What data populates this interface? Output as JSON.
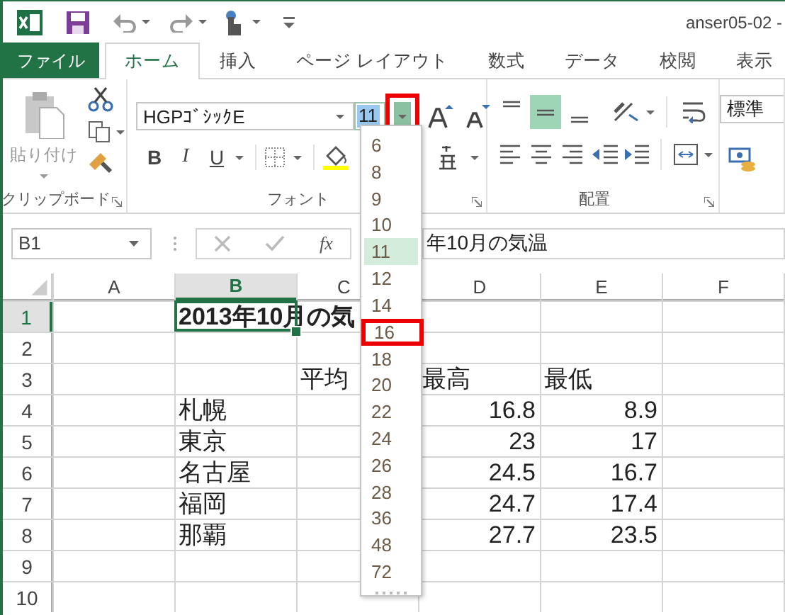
{
  "title_bar": {
    "title": "anser05-02 -"
  },
  "tabs": [
    {
      "label": "ファイル",
      "kind": "file",
      "selected": false
    },
    {
      "label": "ホーム",
      "kind": "tab",
      "selected": true
    },
    {
      "label": "挿入",
      "kind": "tab",
      "selected": false
    },
    {
      "label": "ページ レイアウト",
      "kind": "tab",
      "selected": false
    },
    {
      "label": "数式",
      "kind": "tab",
      "selected": false
    },
    {
      "label": "データ",
      "kind": "tab",
      "selected": false
    },
    {
      "label": "校閲",
      "kind": "tab",
      "selected": false
    },
    {
      "label": "表示",
      "kind": "tab",
      "selected": false
    }
  ],
  "ribbon": {
    "clipboard": {
      "paste_label": "貼り付け",
      "group_label": "クリップボード"
    },
    "font": {
      "font_name": "HGPｺﾞｼｯｸE",
      "font_size": "11",
      "size_button_annotated": true,
      "bold": "B",
      "italic": "I",
      "underline": "U",
      "group_label": "フォント"
    },
    "alignment": {
      "group_label": "配置",
      "vertical_buttons": [
        {
          "kind": "top",
          "selected": false
        },
        {
          "kind": "middle",
          "selected": true
        },
        {
          "kind": "bottom",
          "selected": false
        }
      ]
    },
    "number": {
      "format": "標準"
    }
  },
  "font_size_menu": {
    "items": [
      {
        "label": "6",
        "selected": false,
        "annotated": false
      },
      {
        "label": "8",
        "selected": false,
        "annotated": false
      },
      {
        "label": "9",
        "selected": false,
        "annotated": false
      },
      {
        "label": "10",
        "selected": false,
        "annotated": false
      },
      {
        "label": "11",
        "selected": true,
        "annotated": false
      },
      {
        "label": "12",
        "selected": false,
        "annotated": false
      },
      {
        "label": "14",
        "selected": false,
        "annotated": false
      },
      {
        "label": "16",
        "selected": false,
        "annotated": true
      },
      {
        "label": "18",
        "selected": false,
        "annotated": false
      },
      {
        "label": "20",
        "selected": false,
        "annotated": false
      },
      {
        "label": "22",
        "selected": false,
        "annotated": false
      },
      {
        "label": "24",
        "selected": false,
        "annotated": false
      },
      {
        "label": "26",
        "selected": false,
        "annotated": false
      },
      {
        "label": "28",
        "selected": false,
        "annotated": false
      },
      {
        "label": "36",
        "selected": false,
        "annotated": false
      },
      {
        "label": "48",
        "selected": false,
        "annotated": false
      },
      {
        "label": "72",
        "selected": false,
        "annotated": false
      }
    ]
  },
  "formula_bar": {
    "name_box": "B1",
    "function_label": "fx",
    "content": "年10月の気温"
  },
  "sheet": {
    "columns": [
      {
        "label": "A",
        "selected": false
      },
      {
        "label": "B",
        "selected": true
      },
      {
        "label": "C",
        "selected": false
      },
      {
        "label": "D",
        "selected": false
      },
      {
        "label": "E",
        "selected": false
      },
      {
        "label": "F",
        "selected": false
      }
    ],
    "rows": [
      {
        "number": "1",
        "selected": true,
        "cells": [
          null,
          {
            "text": "2013年10月の気",
            "kind": "title",
            "selected": true
          },
          null,
          null,
          null,
          null
        ]
      },
      {
        "number": "2",
        "selected": false,
        "cells": [
          null,
          null,
          null,
          null,
          null,
          null
        ]
      },
      {
        "number": "3",
        "selected": false,
        "cells": [
          null,
          null,
          {
            "text": "平均",
            "kind": "text",
            "selected": false
          },
          {
            "text": "最高",
            "kind": "text",
            "selected": false
          },
          {
            "text": "最低",
            "kind": "text",
            "selected": false
          },
          null
        ]
      },
      {
        "number": "4",
        "selected": false,
        "cells": [
          null,
          {
            "text": "札幌",
            "kind": "text",
            "selected": false
          },
          null,
          {
            "text": "16.8",
            "kind": "number",
            "selected": false
          },
          {
            "text": "8.9",
            "kind": "number",
            "selected": false
          },
          null
        ]
      },
      {
        "number": "5",
        "selected": false,
        "cells": [
          null,
          {
            "text": "東京",
            "kind": "text",
            "selected": false
          },
          null,
          {
            "text": "23",
            "kind": "number",
            "selected": false
          },
          {
            "text": "17",
            "kind": "number",
            "selected": false
          },
          null
        ]
      },
      {
        "number": "6",
        "selected": false,
        "cells": [
          null,
          {
            "text": "名古屋",
            "kind": "text",
            "selected": false
          },
          null,
          {
            "text": "24.5",
            "kind": "number",
            "selected": false
          },
          {
            "text": "16.7",
            "kind": "number",
            "selected": false
          },
          null
        ]
      },
      {
        "number": "7",
        "selected": false,
        "cells": [
          null,
          {
            "text": "福岡",
            "kind": "text",
            "selected": false
          },
          null,
          {
            "text": "24.7",
            "kind": "number",
            "selected": false
          },
          {
            "text": "17.4",
            "kind": "number",
            "selected": false
          },
          null
        ]
      },
      {
        "number": "8",
        "selected": false,
        "cells": [
          null,
          {
            "text": "那覇",
            "kind": "text",
            "selected": false
          },
          null,
          {
            "text": "27.7",
            "kind": "number",
            "selected": false
          },
          {
            "text": "23.5",
            "kind": "number",
            "selected": false
          },
          null
        ]
      },
      {
        "number": "9",
        "selected": false,
        "cells": [
          null,
          null,
          null,
          null,
          null,
          null
        ]
      },
      {
        "number": "10",
        "selected": false,
        "cells": [
          null,
          null,
          null,
          null,
          null,
          null
        ]
      }
    ]
  }
}
